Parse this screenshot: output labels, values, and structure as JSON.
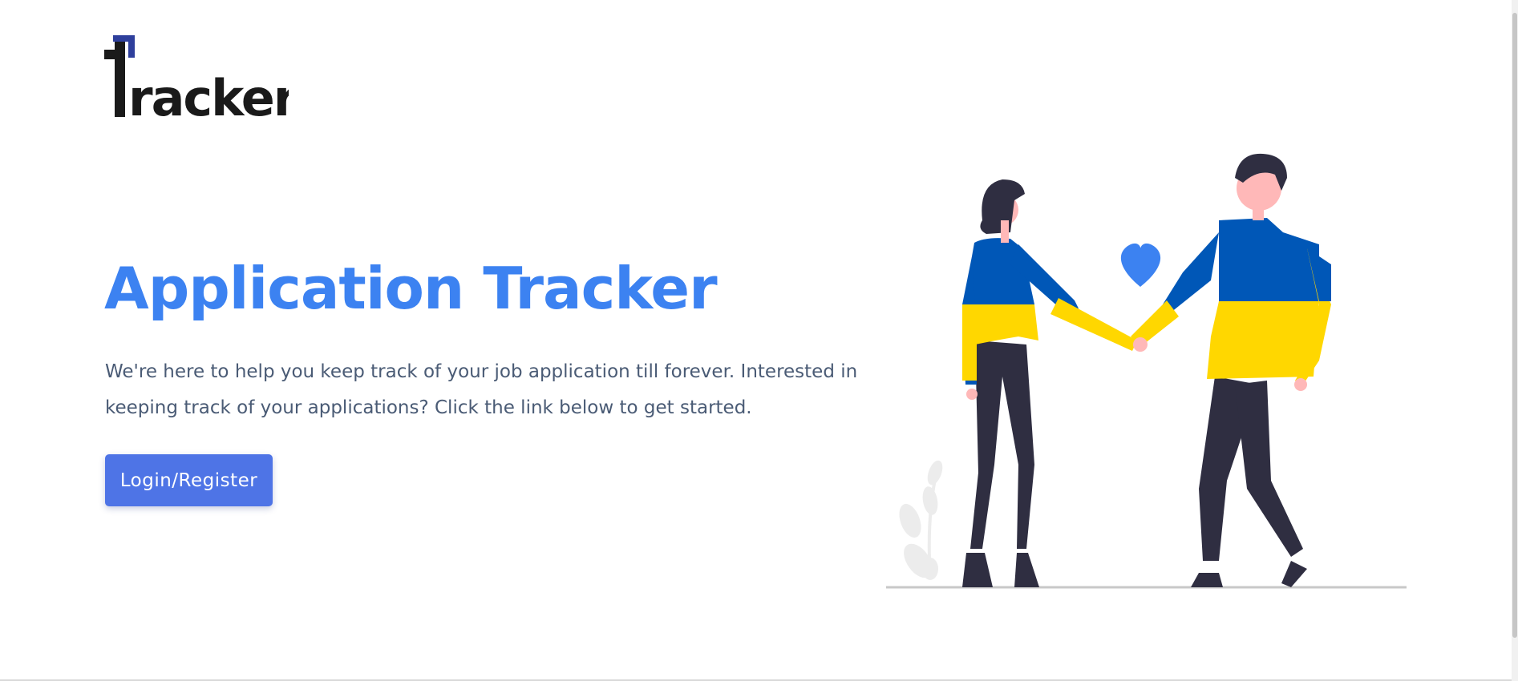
{
  "brand": {
    "logo_text": "Tracker",
    "accent_color": "#2e3f9c",
    "ink_color": "#1a1a1a"
  },
  "hero": {
    "title": "Application Tracker",
    "description": "We're here to help you keep track of your job application till forever. Interested in keeping track of your applications? Click the link below to get started.",
    "cta_label": "Login/Register",
    "title_color": "#3c82f1",
    "button_color": "#4e74e6"
  },
  "illustration": {
    "subject": "couple-holding-hands-illustration",
    "flag_colors": [
      "#0057b7",
      "#ffd700"
    ],
    "heart_color": "#3c82f1"
  }
}
